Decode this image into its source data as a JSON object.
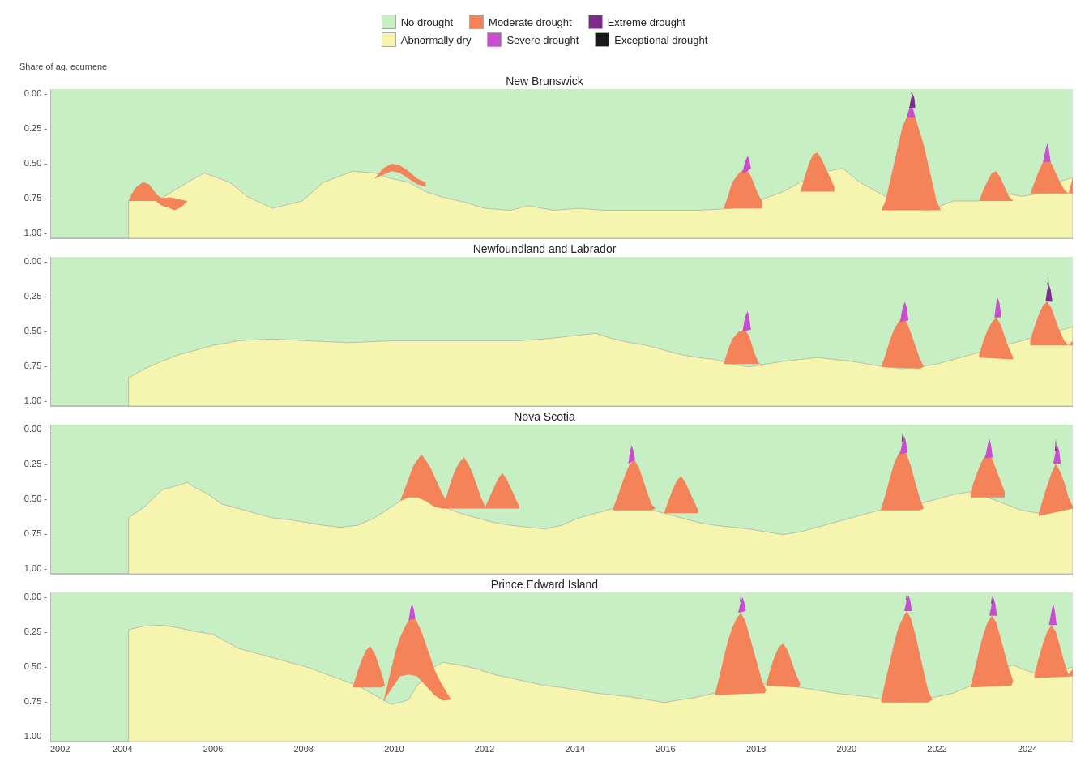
{
  "legend": {
    "items": [
      {
        "label": "No drought",
        "color": "#c8eec4",
        "row": 0
      },
      {
        "label": "Moderate drought",
        "color": "#f4835a",
        "row": 0
      },
      {
        "label": "Extreme drought",
        "color": "#7b2d8b",
        "row": 0
      },
      {
        "label": "Abnormally dry",
        "color": "#f5f5b0",
        "row": 1
      },
      {
        "label": "Severe drought",
        "color": "#c94ecf",
        "row": 1
      },
      {
        "label": "Exceptional drought",
        "color": "#1a1a1a",
        "row": 1
      }
    ]
  },
  "yaxis_label": "Share of ag. ecumene",
  "y_ticks": [
    "0.00",
    "0.25",
    "0.50",
    "0.75",
    "1.00"
  ],
  "x_ticks": [
    "2002",
    "2004",
    "2006",
    "2008",
    "2010",
    "2012",
    "2014",
    "2016",
    "2018",
    "2020",
    "2022",
    "2024"
  ],
  "charts": [
    {
      "title": "New Brunswick",
      "id": "new-brunswick"
    },
    {
      "title": "Newfoundland and Labrador",
      "id": "newfoundland-labrador"
    },
    {
      "title": "Nova Scotia",
      "id": "nova-scotia"
    },
    {
      "title": "Prince Edward Island",
      "id": "prince-edward-island"
    }
  ]
}
